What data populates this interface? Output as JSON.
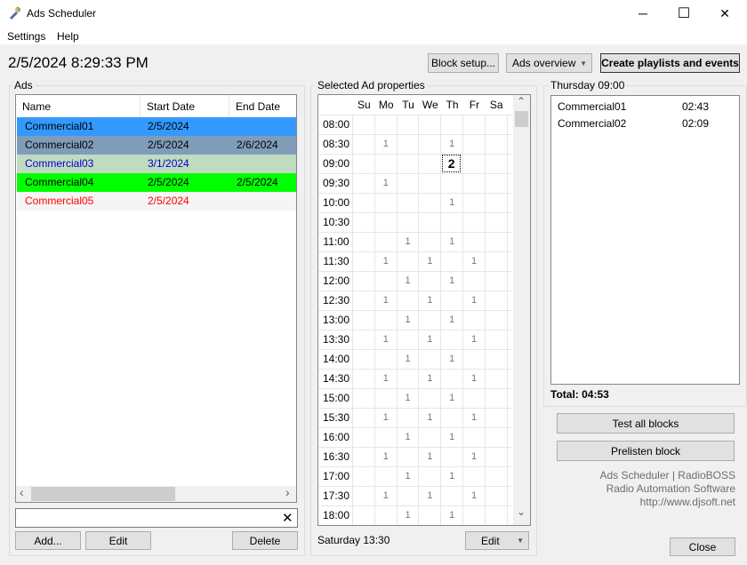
{
  "window": {
    "title": "Ads Scheduler",
    "minimize": "─",
    "maximize": "☐",
    "close": "✕"
  },
  "menu": {
    "settings": "Settings",
    "help": "Help"
  },
  "datetime": "2/5/2024 8:29:33 PM",
  "toolbar": {
    "block_setup": "Block setup...",
    "ads_overview": "Ads overview",
    "ads_overview_arrow": "▼",
    "create_playlists": "Create playlists and events"
  },
  "ads": {
    "group_label": "Ads",
    "columns": [
      "Name",
      "Start Date",
      "End Date"
    ],
    "rows": [
      {
        "name": "Commercial01",
        "start": "2/5/2024",
        "end": "",
        "bg": "#3399ff",
        "fg": "#000000"
      },
      {
        "name": "Commercial02",
        "start": "2/5/2024",
        "end": "2/6/2024",
        "bg": "#7f9db9",
        "fg": "#000000"
      },
      {
        "name": "Commercial03",
        "start": "3/1/2024",
        "end": "",
        "bg": "#c0dcc0",
        "fg": "#0000cc"
      },
      {
        "name": "Commercial04",
        "start": "2/5/2024",
        "end": "2/5/2024",
        "bg": "#00ff00",
        "fg": "#000000"
      },
      {
        "name": "Commercial05",
        "start": "2/5/2024",
        "end": "",
        "bg": "#f5f5f5",
        "fg": "#ff0000"
      }
    ],
    "scroll_left": "‹",
    "scroll_right": "›",
    "search_value": "",
    "clear_icon": "✕",
    "add_button": "Add...",
    "edit_button": "Edit",
    "delete_button": "Delete"
  },
  "ad_properties": {
    "group_label": "Selected Ad properties",
    "days": [
      "Su",
      "Mo",
      "Tu",
      "We",
      "Th",
      "Fr",
      "Sa"
    ],
    "times": [
      "08:00",
      "08:30",
      "09:00",
      "09:30",
      "10:00",
      "10:30",
      "11:00",
      "11:30",
      "12:00",
      "12:30",
      "13:00",
      "13:30",
      "14:00",
      "14:30",
      "15:00",
      "15:30",
      "16:00",
      "16:30",
      "17:00",
      "17:30",
      "18:00"
    ],
    "grid": [
      [
        "",
        "",
        "",
        "",
        "",
        "",
        ""
      ],
      [
        "",
        "1",
        "",
        "",
        "1",
        "",
        ""
      ],
      [
        "",
        "",
        "",
        "",
        "2",
        "",
        ""
      ],
      [
        "",
        "1",
        "",
        "",
        "",
        "",
        ""
      ],
      [
        "",
        "",
        "",
        "",
        "1",
        "",
        ""
      ],
      [
        "",
        "",
        "",
        "",
        "",
        "",
        ""
      ],
      [
        "",
        "",
        "1",
        "",
        "1",
        "",
        ""
      ],
      [
        "",
        "1",
        "",
        "1",
        "",
        "1",
        ""
      ],
      [
        "",
        "",
        "1",
        "",
        "1",
        "",
        ""
      ],
      [
        "",
        "1",
        "",
        "1",
        "",
        "1",
        ""
      ],
      [
        "",
        "",
        "1",
        "",
        "1",
        "",
        ""
      ],
      [
        "",
        "1",
        "",
        "1",
        "",
        "1",
        ""
      ],
      [
        "",
        "",
        "1",
        "",
        "1",
        "",
        ""
      ],
      [
        "",
        "1",
        "",
        "1",
        "",
        "1",
        ""
      ],
      [
        "",
        "",
        "1",
        "",
        "1",
        "",
        ""
      ],
      [
        "",
        "1",
        "",
        "1",
        "",
        "1",
        ""
      ],
      [
        "",
        "",
        "1",
        "",
        "1",
        "",
        ""
      ],
      [
        "",
        "1",
        "",
        "1",
        "",
        "1",
        ""
      ],
      [
        "",
        "",
        "1",
        "",
        "1",
        "",
        ""
      ],
      [
        "",
        "1",
        "",
        "1",
        "",
        "1",
        ""
      ],
      [
        "",
        "",
        "1",
        "",
        "1",
        "",
        ""
      ]
    ],
    "status": "Saturday 13:30",
    "edit_button": "Edit",
    "edit_arrow": "▼",
    "scroll_up": "⌃",
    "scroll_down": "⌄"
  },
  "block": {
    "title": "Thursday 09:00",
    "items": [
      {
        "name": "Commercial01",
        "duration": "02:43"
      },
      {
        "name": "Commercial02",
        "duration": "02:09"
      }
    ],
    "total": "Total: 04:53",
    "test_all": "Test all blocks",
    "prelisten": "Prelisten block"
  },
  "info": {
    "line1": "Ads Scheduler | RadioBOSS",
    "line2": "Radio Automation Software",
    "line3": "http://www.djsoft.net"
  },
  "close_button": "Close"
}
